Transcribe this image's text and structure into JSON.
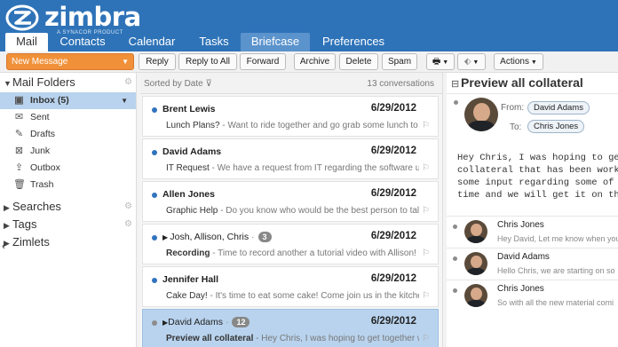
{
  "brand": {
    "name": "zimbra",
    "tagline": "A SYNACOR PRODUCT"
  },
  "colors": {
    "header": "#2e73b8",
    "new_message": "#f0913a",
    "selection": "#b9d3ee",
    "unread_dot": "#3173bd"
  },
  "tabs": [
    {
      "label": "Mail"
    },
    {
      "label": "Contacts"
    },
    {
      "label": "Calendar"
    },
    {
      "label": "Tasks"
    },
    {
      "label": "Briefcase"
    },
    {
      "label": "Preferences"
    }
  ],
  "toolbar": {
    "new_message": "New Message",
    "reply": "Reply",
    "reply_all": "Reply to All",
    "forward": "Forward",
    "archive": "Archive",
    "delete": "Delete",
    "spam": "Spam",
    "actions": "Actions"
  },
  "sidebar": {
    "mail_folders": "Mail Folders",
    "folders": [
      {
        "label": "Inbox (5)",
        "icon": "inbox-icon"
      },
      {
        "label": "Sent",
        "icon": "sent-icon"
      },
      {
        "label": "Drafts",
        "icon": "drafts-icon"
      },
      {
        "label": "Junk",
        "icon": "junk-icon"
      },
      {
        "label": "Outbox",
        "icon": "outbox-icon"
      },
      {
        "label": "Trash",
        "icon": "trash-icon"
      }
    ],
    "searches": "Searches",
    "tags": "Tags",
    "zimlets": "Zimlets"
  },
  "list": {
    "sort": "Sorted by Date",
    "count": "13 conversations",
    "messages": [
      {
        "from": "Brent Lewis",
        "date": "6/29/2012",
        "subject": "Lunch Plans?",
        "fragment": " - Want to ride together and go grab some lunch to talk"
      },
      {
        "from": "David Adams",
        "date": "6/29/2012",
        "subject": "IT Request",
        "fragment": " - We have a request from IT regarding the software upda"
      },
      {
        "from": "Allen Jones",
        "date": "6/29/2012",
        "subject": "Graphic Help",
        "fragment": " - Do you know who would be the best person to talk t"
      },
      {
        "from": "Josh, Allison, Chris",
        "date": "6/29/2012",
        "subject": "Recording",
        "fragment": " - Time to record another a tutorial video with Allison! Let",
        "badge": "3"
      },
      {
        "from": "Jennifer Hall",
        "date": "6/29/2012",
        "subject": "Cake Day!",
        "fragment": " - It's time to eat some cake! Come join us in the kitchen a"
      },
      {
        "from": "David Adams",
        "date": "6/29/2012",
        "subject": "Preview all collateral",
        "fragment": " - Hey Chris, I was hoping to get together with",
        "badge": "12"
      }
    ]
  },
  "reading": {
    "title": "Preview all collateral",
    "from_label": "From:",
    "from": "David Adams",
    "to_label": "To:",
    "to": "Chris Jones",
    "body": "Hey Chris, I was hoping to get\ncollateral that has been worke\nsome input regarding some of t\ntime and we will get it on the",
    "conversation": [
      {
        "name": "Chris Jones",
        "fragment": "Hey David, Let me know when you"
      },
      {
        "name": "David Adams",
        "fragment": "Hello Chris, we are starting on so"
      },
      {
        "name": "Chris Jones",
        "fragment": "So with all the new material comi"
      }
    ]
  }
}
